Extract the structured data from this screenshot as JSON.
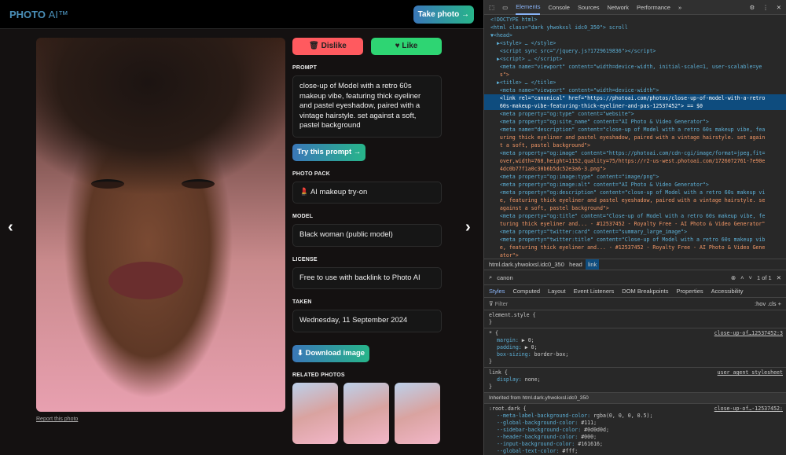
{
  "site": {
    "logo": "PHOTO",
    "logo_ai": "AI™",
    "take_photo": "Take photo →",
    "dislike": "🗑 Dislike",
    "like": "♥ Like",
    "prompt_label": "PROMPT",
    "prompt": "close-up of Model with a retro 60s makeup vibe, featuring thick eyeliner and pastel eyeshadow, paired with a vintage hairstyle. set against a soft, pastel background",
    "try_prompt": "Try this prompt →",
    "pack_label": "PHOTO PACK",
    "pack": "💄 AI makeup try-on",
    "model_label": "MODEL",
    "model": "Black woman (public model)",
    "license_label": "LICENSE",
    "license": "Free to use with backlink to Photo AI",
    "taken_label": "TAKEN",
    "taken": "Wednesday, 11 September 2024",
    "download": "⬇ Download image",
    "related_label": "RELATED PHOTOS",
    "report": "Report this photo",
    "prev": "‹",
    "next": "›"
  },
  "devtools": {
    "tabs": [
      "Elements",
      "Console",
      "Sources",
      "Network",
      "Performance"
    ],
    "more": "»",
    "tree": [
      "<!DOCTYPE html>",
      "<html class=\"dark yhwokxsl idc0_350\"> scroll",
      "▼<head>",
      "  ▶<style> … </style>",
      "   <script sync src=\"/jquery.js?1729619836\"></script>",
      "  ▶<script> … </script>",
      "   <meta name=\"viewport\" content=\"width=device-width, initial-scale=1, user-scalable=ye",
      "   s\">",
      "  ▶<title> … </title>",
      "   <meta name=\"viewport\" content=\"width=device-width\">",
      "   <link rel=\"canonical\" href=\"https://photoai.com/photos/close-up-of-model-with-a-retro",
      "   60s-makeup-vibe-featuring-thick-eyeliner-and-pas-12537452\"> == $0",
      "   <meta property=\"og:type\" content=\"website\">",
      "   <meta property=\"og:site_name\" content=\"AI Photo & Video Generator\">",
      "   <meta name=\"description\" content=\"close-up of Model with a retro 60s makeup vibe, fea",
      "   uring thick eyeliner and pastel eyeshadow, paired with a vintage hairstyle. set again",
      "   t a soft, pastel background\">",
      "   <meta property=\"og:image\" content=\"https://photoai.com/cdn-cgi/image/format=jpeg,fit=",
      "   over,width=768,height=1152,quality=75/https://r2-us-west.photoai.com/1726072761-7e90e",
      "   4dc0b77f1a0c30b6b5dc52e3a6-3.png\">",
      "   <meta property=\"og:image:type\" content=\"image/png\">",
      "   <meta property=\"og:image:alt\" content=\"AI Photo & Video Generator\">",
      "   <meta property=\"og:description\" content=\"close-up of Model with a retro 60s makeup vi",
      "   e, featuring thick eyeliner and pastel eyeshadow, paired with a vintage hairstyle. se",
      "   against a soft, pastel background\">",
      "   <meta property=\"og:title\" content=\"Close-up of Model with a retro 60s makeup vibe, fe",
      "   turing thick eyeliner and... - #12537452 - Royalty Free - AI Photo & Video Generator\"",
      "   <meta property=\"twitter:card\" content=\"summary_large_image\">",
      "   <meta property=\"twitter:title\" content=\"Close-up of Model with a retro 60s makeup vib",
      "   e, featuring thick eyeliner and... - #12537452 - Royalty Free - AI Photo & Video Gene",
      "   ator\">"
    ],
    "crumbs": [
      "html.dark.yhwokxsl.idc0_350",
      "head",
      "link"
    ],
    "search": "canon",
    "match": "1 of 1",
    "style_tabs": [
      "Styles",
      "Computed",
      "Layout",
      "Event Listeners",
      "DOM Breakpoints",
      "Properties",
      "Accessibility"
    ],
    "filter": "Filter",
    "filter_tools": ":hov .cls +",
    "rules": [
      {
        "sel": "element.style {",
        "lines": [],
        "end": "}",
        "src": ""
      },
      {
        "sel": "* {",
        "lines": [
          "margin: ▶ 0;",
          "padding: ▶ 0;",
          "box-sizing: border-box;"
        ],
        "end": "}",
        "src": "close-up-of…12537452:3"
      },
      {
        "sel": "link {",
        "lines": [
          "display: none;"
        ],
        "end": "}",
        "src": "user agent stylesheet"
      }
    ],
    "inherited": "Inherited from html.dark.yhwokxsl.idc0_350",
    "root": {
      "sel": ":root.dark {",
      "src": "close-up-of…-12537452:",
      "lines": [
        "--meta-label-background-color: rgba(0, 0, 0, 0.5);",
        "--global-background-color: #111;",
        "--sidebar-background-color: #0d0d0d;",
        "--header-background-color: #000;",
        "--input-background-color: #161616;",
        "--global-text-color: #fff;"
      ]
    }
  },
  "colors": {
    "dislike": "#ff5a5f",
    "like": "#2ed573",
    "accent": "#3a77b8"
  }
}
